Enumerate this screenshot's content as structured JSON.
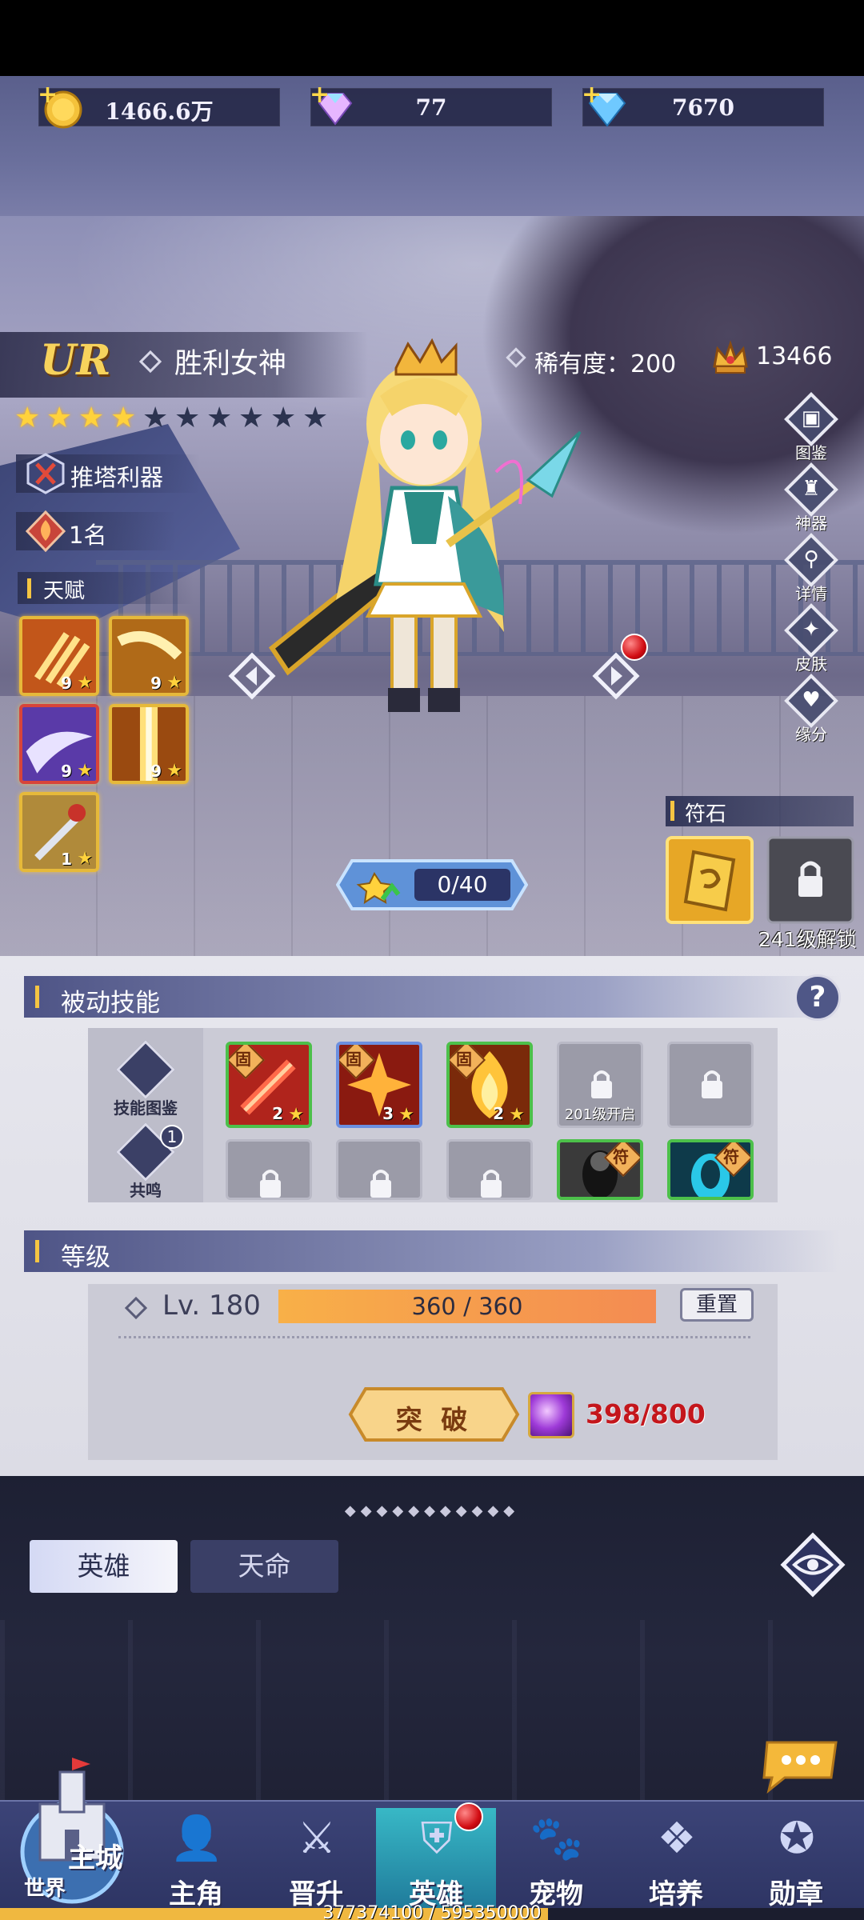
{
  "currencies": [
    {
      "id": "gold",
      "value": "1466.6万"
    },
    {
      "id": "crystal",
      "value": "77"
    },
    {
      "id": "diamond",
      "value": "7670"
    }
  ],
  "hero": {
    "grade": "UR",
    "name": "胜利女神",
    "rarity_label": "稀有度：",
    "rarity_value": "200",
    "power": "13466",
    "stars_total": 10,
    "stars_filled": 4,
    "role_tag": "推塔利器",
    "rank_tag": "1名"
  },
  "talent": {
    "title": "天赋",
    "skills": [
      {
        "level": "9",
        "frame": "gold"
      },
      {
        "level": "9",
        "frame": "gold"
      },
      {
        "level": "9",
        "frame": "red"
      },
      {
        "level": "9",
        "frame": "gold"
      },
      {
        "level": "1",
        "frame": "gold"
      }
    ]
  },
  "side_menu": [
    "图鉴",
    "神器",
    "详情",
    "皮肤",
    "缘分"
  ],
  "exp_progress": "0/40",
  "rune": {
    "title": "符石",
    "unlock_text": "241级解锁"
  },
  "passive": {
    "title": "被动技能",
    "help": "?",
    "side": [
      {
        "label": "技能图鉴"
      },
      {
        "label": "共鸣",
        "badge": "1"
      }
    ],
    "fixed_badge": "固",
    "cross_badge": "符",
    "row1": [
      {
        "state": "owned",
        "level": "2"
      },
      {
        "state": "owned",
        "level": "3"
      },
      {
        "state": "owned",
        "level": "2"
      },
      {
        "state": "locked",
        "unlock": "201级开启"
      },
      {
        "state": "locked",
        "unlock": ""
      }
    ]
  },
  "level": {
    "title": "等级",
    "label": "Lv. 180",
    "xp": "360 / 360",
    "reset": "重置",
    "breakthrough": "突 破",
    "material_count": "398/800"
  },
  "bottom_tabs": {
    "active": "英雄",
    "inactive": "天命"
  },
  "nav": {
    "castle_main": "主城",
    "castle_world": "世界",
    "items": [
      "主角",
      "晋升",
      "英雄",
      "宠物",
      "培养",
      "勋章"
    ],
    "active_index": 2
  },
  "account_exp": {
    "text": "377374100 / 595350000",
    "fraction": 0.634
  },
  "colors": {
    "accent_gold": "#f5c542",
    "danger_red": "#c4161c",
    "nav_active": "#38b8c6"
  }
}
